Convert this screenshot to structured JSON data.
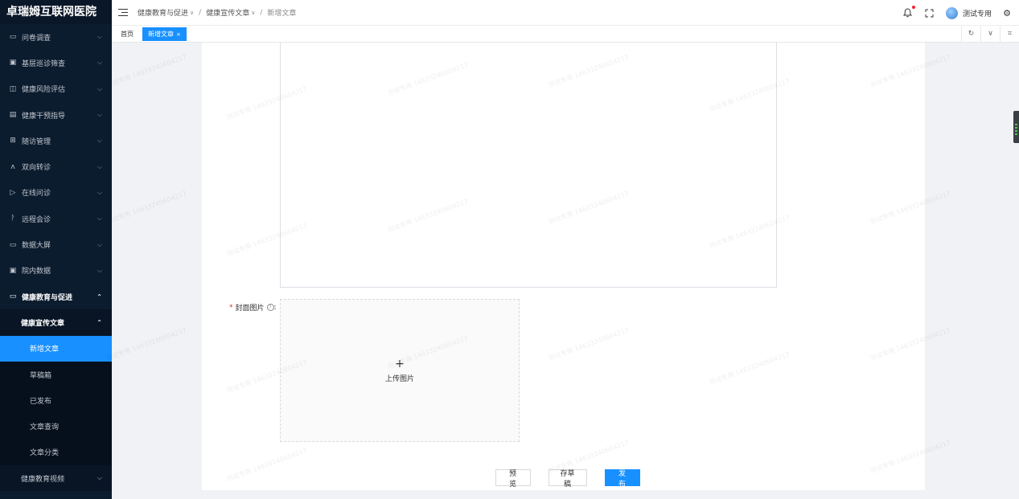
{
  "app": {
    "title": "卓瑞姆互联网医院"
  },
  "sidebar": {
    "items": [
      {
        "label": "问卷调查",
        "icon": "survey-icon"
      },
      {
        "label": "基层巡诊筛查",
        "icon": "screening-icon"
      },
      {
        "label": "健康风险评估",
        "icon": "risk-assessment-icon"
      },
      {
        "label": "健康干预指导",
        "icon": "intervention-icon"
      },
      {
        "label": "随访管理",
        "icon": "followup-icon"
      },
      {
        "label": "双向转诊",
        "icon": "referral-icon"
      },
      {
        "label": "在线问诊",
        "icon": "consultation-icon"
      },
      {
        "label": "远程会诊",
        "icon": "remote-consult-icon"
      },
      {
        "label": "数据大屏",
        "icon": "dashboard-icon"
      },
      {
        "label": "院内数据",
        "icon": "hospital-data-icon"
      },
      {
        "label": "健康教育与促进",
        "icon": "health-education-icon"
      }
    ],
    "submenu": {
      "label": "健康宣传文章",
      "children": [
        "新增文章",
        "草稿箱",
        "已发布",
        "文章查询",
        "文章分类"
      ]
    },
    "submenu2": {
      "label": "健康教育视频"
    }
  },
  "header": {
    "breadcrumb": [
      "健康教育与促进",
      "健康宣传文章",
      "新增文章"
    ],
    "username": "测试专用"
  },
  "tabs": [
    {
      "label": "首页"
    },
    {
      "label": "新增文章"
    }
  ],
  "form": {
    "cover_label": "封面图片",
    "cover_colon": ":",
    "upload_text": "上传图片",
    "upload_plus": "+"
  },
  "actions": {
    "preview": "预 览",
    "save_draft": "存草稿",
    "publish": "发 布"
  },
  "watermark": {
    "text": "测试专用 14633240604217"
  },
  "colors": {
    "sidebar_bg": "#0c1c2f",
    "primary": "#1890ff",
    "required": "#f5222d"
  }
}
